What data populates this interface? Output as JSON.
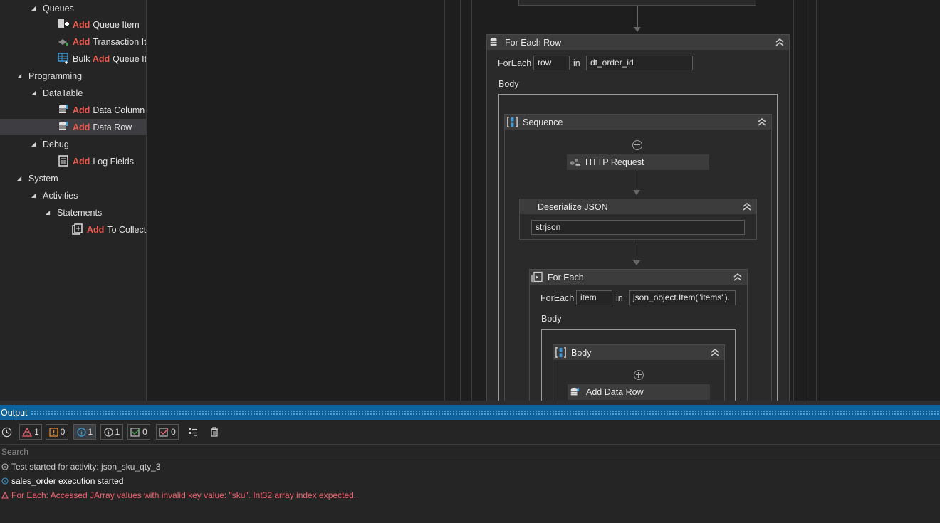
{
  "tree": {
    "queues": "Queues",
    "add_queue_item": {
      "hl": "Add",
      "rest": "Queue Item"
    },
    "add_transaction_item": {
      "hl": "Add",
      "rest": "Transaction Ite"
    },
    "bulk_add_queue": {
      "pre": "Bulk",
      "hl": "Add",
      "rest": "Queue Ite"
    },
    "programming": "Programming",
    "datatable": "DataTable",
    "add_data_column": {
      "hl": "Add",
      "rest": "Data Column"
    },
    "add_data_row": {
      "hl": "Add",
      "rest": "Data Row"
    },
    "debug": "Debug",
    "add_log_fields": {
      "hl": "Add",
      "rest": "Log Fields"
    },
    "system": "System",
    "activities": "Activities",
    "statements": "Statements",
    "add_to_collection": {
      "hl": "Add",
      "rest": "To Collecti"
    }
  },
  "workflow": {
    "for_each_row": {
      "title": "For Each Row",
      "foreach_label": "ForEach",
      "var": "row",
      "in_label": "in",
      "collection": "dt_order_id",
      "body_label": "Body"
    },
    "sequence": {
      "title": "Sequence"
    },
    "http_request": {
      "title": "HTTP Request"
    },
    "deserialize": {
      "title": "Deserialize JSON",
      "input": "strjson"
    },
    "for_each": {
      "title": "For Each",
      "foreach_label": "ForEach",
      "var": "item",
      "in_label": "in",
      "collection": "json_object.Item(\"items\").",
      "body_label": "Body"
    },
    "inner_body": {
      "title": "Body"
    },
    "add_data_row": {
      "title": "Add Data Row"
    }
  },
  "output": {
    "title": "Output",
    "counts": {
      "errors": "1",
      "warnings": "0",
      "info": "1",
      "trace": "1",
      "success": "0",
      "failed": "0"
    },
    "search_placeholder": "Search",
    "logs": [
      {
        "text": "Test started for activity: json_sku_qty_3",
        "color": "#cccccc"
      },
      {
        "text": "sales_order execution started",
        "color": "#ffffff"
      },
      {
        "text": "For Each: Accessed JArray values with invalid key value: \"sku\". Int32 array index expected.",
        "color": "#f0606a"
      }
    ]
  },
  "colors": {
    "accent": "#0e639c",
    "highlight": "#f05a50",
    "error": "#f0606a"
  }
}
